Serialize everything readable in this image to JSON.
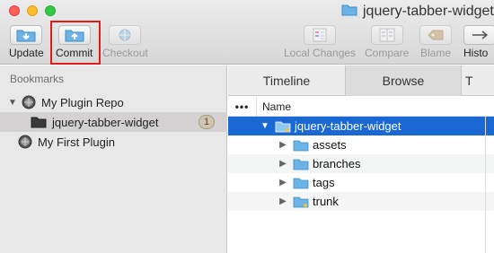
{
  "window": {
    "title": "jquery-tabber-widget"
  },
  "toolbar": {
    "update_label": "Update",
    "commit_label": "Commit",
    "checkout_label": "Checkout",
    "local_changes_label": "Local Changes",
    "compare_label": "Compare",
    "blame_label": "Blame",
    "history_label": "Histo"
  },
  "sidebar": {
    "header": "Bookmarks",
    "items": [
      {
        "label": "My Plugin Repo",
        "expanded": true
      },
      {
        "label": "jquery-tabber-widget",
        "badge": "1"
      },
      {
        "label": "My First Plugin"
      }
    ]
  },
  "tabs": [
    {
      "label": "Timeline"
    },
    {
      "label": "Browse",
      "active": true
    },
    {
      "label": "T"
    }
  ],
  "list": {
    "column_dots": "•••",
    "column_name": "Name",
    "root": "jquery-tabber-widget",
    "children": [
      "assets",
      "branches",
      "tags",
      "trunk"
    ]
  },
  "colors": {
    "accent": "#1a68d4",
    "highlight": "#e21b1b",
    "folder": "#6db3e6"
  }
}
